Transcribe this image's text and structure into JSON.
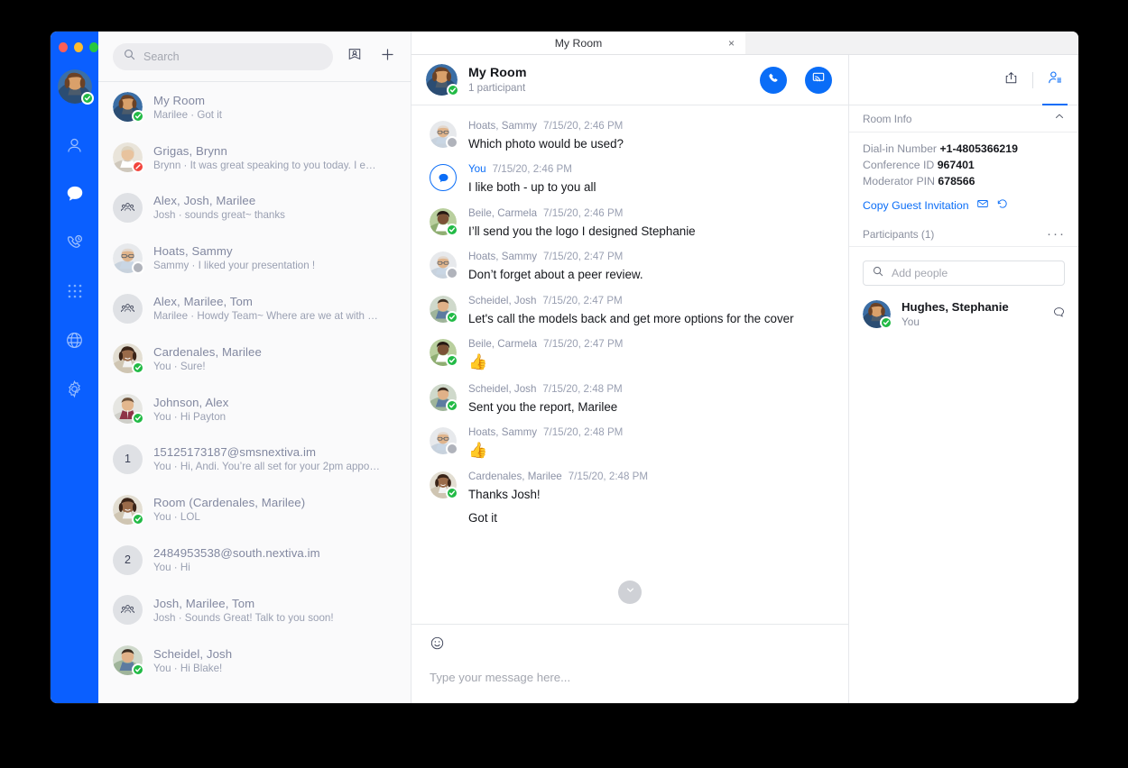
{
  "window": {
    "traffic_lights": [
      "close",
      "minimize",
      "zoom"
    ],
    "colors": {
      "accent": "#0A6DF7",
      "rail": "#0A5FFF",
      "available": "#21BA45",
      "busy": "#F2453D",
      "away": "#B0B3BB"
    }
  },
  "rail": {
    "avatar_name": "Hughes, Stephanie",
    "status": "available",
    "items": [
      {
        "icon": "person-icon",
        "name": "contacts",
        "active": false
      },
      {
        "icon": "chat-bubble-icon",
        "name": "chat",
        "active": true
      },
      {
        "icon": "phone-history-icon",
        "name": "calls",
        "active": false
      },
      {
        "icon": "dialpad-icon",
        "name": "dialpad",
        "active": false
      },
      {
        "icon": "globe-icon",
        "name": "web",
        "active": false
      },
      {
        "icon": "gear-icon",
        "name": "settings",
        "active": false
      }
    ]
  },
  "search": {
    "placeholder": "Search",
    "value": ""
  },
  "conv_header_icons": [
    {
      "icon": "contact-card-icon",
      "name": "contact-card"
    },
    {
      "icon": "plus-icon",
      "name": "new-conversation"
    }
  ],
  "conversations": [
    {
      "title": "My Room",
      "subtitle": "Marilee · Got it",
      "avatar": "photo-stephanie",
      "status": "available",
      "selected": true
    },
    {
      "title": "Grigas, Brynn",
      "subtitle": "Brynn · It was great speaking to you today. I e…",
      "avatar": "photo-brynn",
      "status": "busy"
    },
    {
      "title": "Alex, Josh, Marilee",
      "subtitle": "Josh · sounds great~ thanks",
      "avatar": "group",
      "status": "none"
    },
    {
      "title": "Hoats, Sammy",
      "subtitle": "Sammy · I liked your presentation !",
      "avatar": "photo-sammy",
      "status": "away"
    },
    {
      "title": "Alex, Marilee, Tom",
      "subtitle": "Marilee · Howdy Team~ Where are we at with …",
      "avatar": "group",
      "status": "none"
    },
    {
      "title": "Cardenales, Marilee",
      "subtitle": "You · Sure!",
      "avatar": "photo-marilee",
      "status": "available"
    },
    {
      "title": "Johnson, Alex",
      "subtitle": "You · Hi Payton",
      "avatar": "photo-alex",
      "status": "available"
    },
    {
      "title": "15125173187@smsnextiva.im",
      "subtitle": "You · Hi, Andi. You’re all set for your 2pm appo…",
      "avatar": "number",
      "number": "1",
      "status": "none"
    },
    {
      "title": "Room (Cardenales, Marilee)",
      "subtitle": "You · LOL",
      "avatar": "photo-marilee",
      "status": "available"
    },
    {
      "title": "2484953538@south.nextiva.im",
      "subtitle": "You · Hi",
      "avatar": "number",
      "number": "2",
      "status": "none"
    },
    {
      "title": "Josh, Marilee, Tom",
      "subtitle": "Josh · Sounds Great! Talk to you soon!",
      "avatar": "group",
      "status": "none"
    },
    {
      "title": "Scheidel, Josh",
      "subtitle": "You · Hi Blake!",
      "avatar": "photo-josh",
      "status": "available"
    }
  ],
  "tab": {
    "label": "My Room",
    "close": "×"
  },
  "chat_header": {
    "title": "My Room",
    "subtitle": "1 participant",
    "status": "available",
    "actions": [
      {
        "icon": "phone-icon",
        "name": "start-call"
      },
      {
        "icon": "screen-share-icon",
        "name": "share-screen"
      }
    ]
  },
  "messages": [
    {
      "author": "Hoats, Sammy",
      "time": "7/15/20, 2:46 PM",
      "text": "Which photo would be used?",
      "avatar": "photo-sammy",
      "status": "away",
      "self": false
    },
    {
      "author": "You",
      "time": "7/15/20, 2:46 PM",
      "text": "I like both - up to you all",
      "avatar": "you-bubble",
      "status": "none",
      "self": true
    },
    {
      "author": "Beile, Carmela",
      "time": "7/15/20, 2:46 PM",
      "text": "I’ll send you the logo I designed Stephanie",
      "avatar": "photo-carmela",
      "status": "available",
      "self": false
    },
    {
      "author": "Hoats, Sammy",
      "time": "7/15/20, 2:47 PM",
      "text": "Don’t forget about a peer review.",
      "avatar": "photo-sammy",
      "status": "away",
      "self": false
    },
    {
      "author": "Scheidel, Josh",
      "time": "7/15/20, 2:47 PM",
      "text": "Let's call the models back and get more options for the cover",
      "avatar": "photo-josh",
      "status": "available",
      "self": false
    },
    {
      "author": "Beile, Carmela",
      "time": "7/15/20, 2:47 PM",
      "text": "👍",
      "emoji": true,
      "avatar": "photo-carmela",
      "status": "available",
      "self": false
    },
    {
      "author": "Scheidel, Josh",
      "time": "7/15/20, 2:48 PM",
      "text": "Sent you the report, Marilee",
      "avatar": "photo-josh",
      "status": "available",
      "self": false
    },
    {
      "author": "Hoats, Sammy",
      "time": "7/15/20, 2:48 PM",
      "text": "👍",
      "emoji": true,
      "avatar": "photo-sammy",
      "status": "away",
      "self": false
    },
    {
      "author": "Cardenales, Marilee",
      "time": "7/15/20, 2:48 PM",
      "text": "Thanks Josh!",
      "text2": "Got it",
      "avatar": "photo-marilee",
      "status": "available",
      "self": false
    }
  ],
  "composer": {
    "placeholder": "Type your message here...",
    "value": "",
    "emoji_icon": "emoji-smiley-icon"
  },
  "right_panel": {
    "top_icons": [
      {
        "icon": "share-upload-icon",
        "name": "share",
        "active": false
      },
      {
        "icon": "participants-list-icon",
        "name": "participants",
        "active": true
      }
    ],
    "section_title": "Room Info",
    "collapse_icon": "chevron-up-icon",
    "info": [
      {
        "label": "Dial-in Number",
        "value": "+1-4805366219"
      },
      {
        "label": "Conference ID",
        "value": "967401"
      },
      {
        "label": "Moderator PIN",
        "value": "678566"
      }
    ],
    "copy_invitation": "Copy Guest Invitation",
    "copy_icons": [
      "envelope-icon",
      "reset-icon"
    ],
    "participants_label": "Participants (1)",
    "overflow": "···",
    "add_people_placeholder": "Add people",
    "participants": [
      {
        "name": "Hughes, Stephanie",
        "sub": "You",
        "status": "available",
        "avatar": "photo-stephanie",
        "action_icon": "chat-bubble-outline-icon"
      }
    ]
  }
}
